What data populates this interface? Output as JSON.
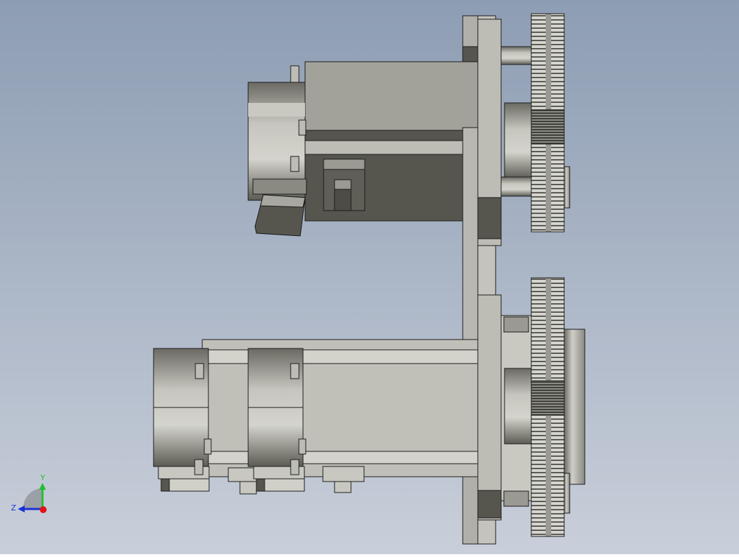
{
  "viewport": {
    "background_top": "#8d9db3",
    "background_bottom": "#c9cfda"
  },
  "triad": {
    "y_label": "Y",
    "z_label": "Z",
    "y_color": "#22c02a",
    "z_color": "#1c2fd6",
    "x_color": "#e01515"
  },
  "colors": {
    "dark_body": "#56564e",
    "mid_body": "#9a9a93",
    "light_body": "#bdbdb6",
    "plate": "#c4c4bd",
    "edge": "#1a1a1a",
    "gear_light": "#d0d0ca",
    "gear_dark": "#4a4a44"
  }
}
